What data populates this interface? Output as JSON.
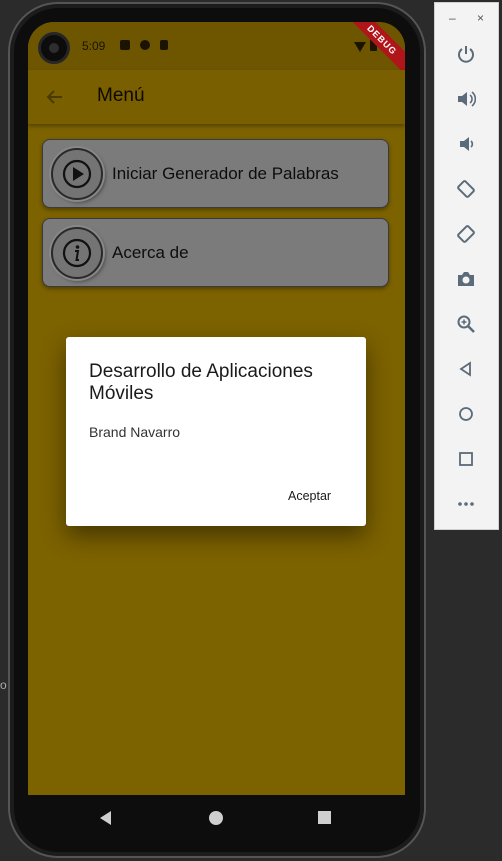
{
  "status_bar": {
    "time": "5:09",
    "debug_label": "DEBUG"
  },
  "app_bar": {
    "title": "Menú"
  },
  "menu": {
    "items": [
      {
        "label": "Iniciar Generador de Palabras",
        "icon": "play-icon"
      },
      {
        "label": "Acerca de",
        "icon": "info-icon"
      }
    ]
  },
  "dialog": {
    "title": "Desarrollo de Aplicaciones Móviles",
    "content": "Brand Navarro",
    "ok_label": "Aceptar"
  },
  "emulator": {
    "minimize": "–",
    "close": "×",
    "buttons": [
      "power-icon",
      "volume-up-icon",
      "volume-down-icon",
      "rotate-left-icon",
      "rotate-right-icon",
      "camera-icon",
      "zoom-icon",
      "back-icon",
      "home-icon",
      "overview-icon",
      "more-icon"
    ]
  },
  "colors": {
    "app_background": "#7d6200",
    "card": "#7b7b7b",
    "dialog": "#ffffff"
  },
  "left_edge": {
    "text": "o"
  }
}
